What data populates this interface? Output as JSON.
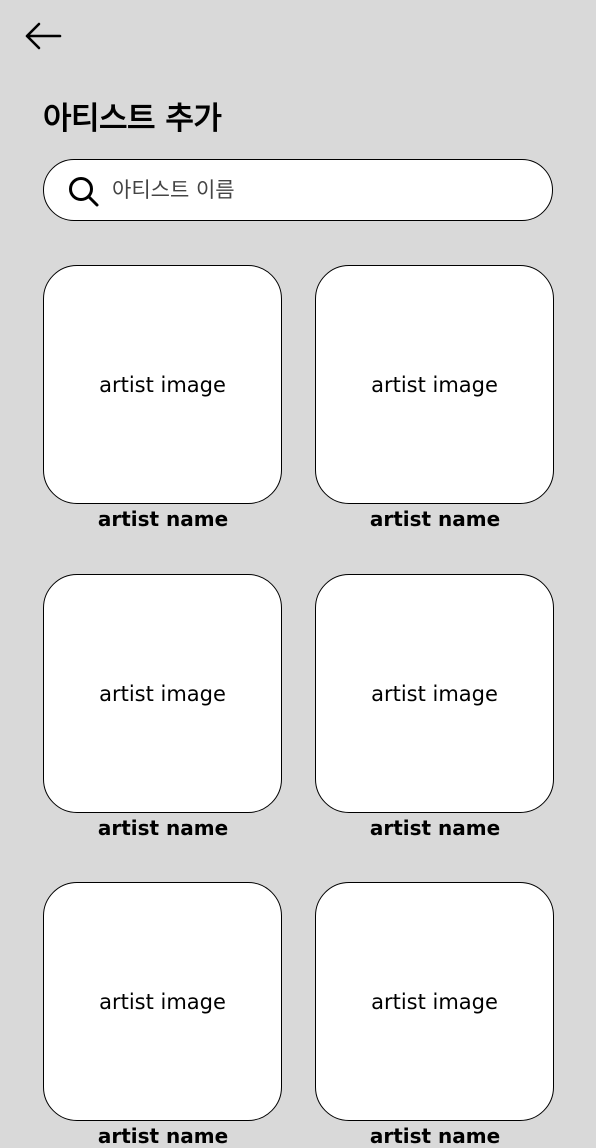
{
  "header": {
    "back_icon": "arrow-left-icon",
    "title": "아티스트 추가"
  },
  "search": {
    "icon": "search-icon",
    "placeholder": "아티스트 이름",
    "value": ""
  },
  "artists": [
    {
      "image_label": "artist image",
      "name": "artist name"
    },
    {
      "image_label": "artist image",
      "name": "artist name"
    },
    {
      "image_label": "artist image",
      "name": "artist name"
    },
    {
      "image_label": "artist image",
      "name": "artist name"
    },
    {
      "image_label": "artist image",
      "name": "artist name"
    },
    {
      "image_label": "artist image",
      "name": "artist name"
    }
  ]
}
